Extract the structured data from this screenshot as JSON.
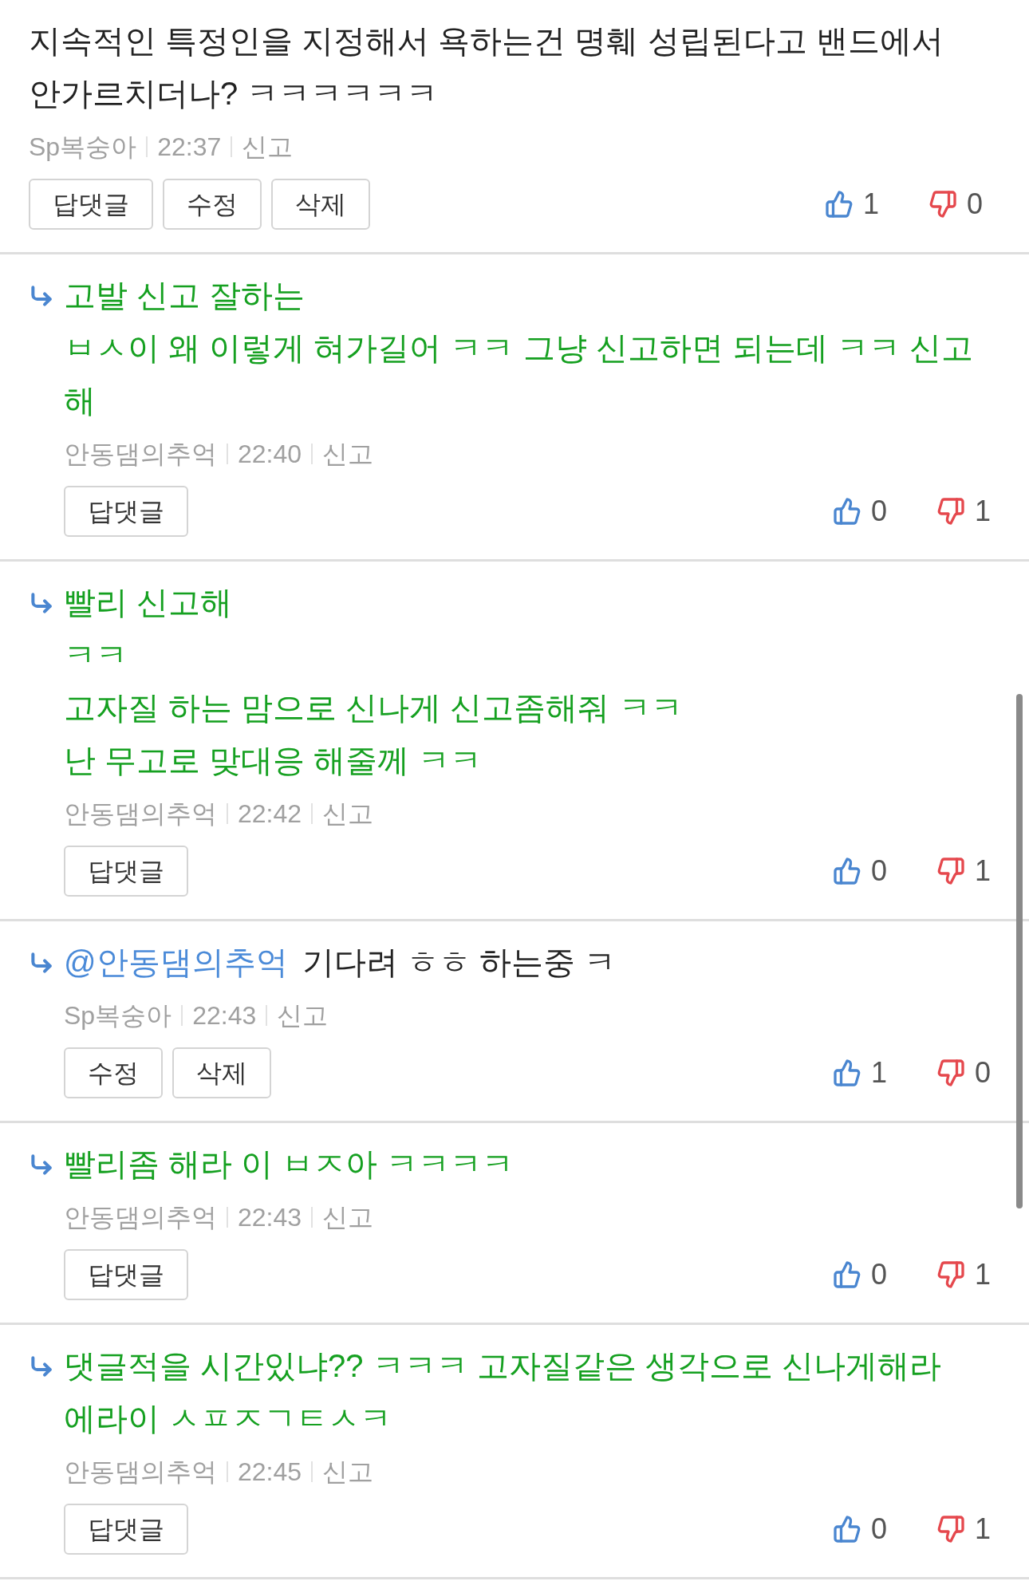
{
  "comments": [
    {
      "reply": false,
      "color": "#222222",
      "lines": [
        "지속적인 특정인을 지정해서 욕하는건 명훼 성립된다고 밴드에서 안가르치더나? ㅋㅋㅋㅋㅋㅋ"
      ],
      "author": "Sp복숭아",
      "time": "22:37",
      "report": "신고",
      "buttons": [
        "답댓글",
        "수정",
        "삭제"
      ],
      "likes": "1",
      "dislikes": "0"
    },
    {
      "reply": true,
      "color": "#15a020",
      "lines": [
        "고발 신고 잘하는",
        "ㅂㅅ이 왜 이렇게 혀가길어 ㅋㅋ 그냥 신고하면 되는데 ㅋㅋ 신고해"
      ],
      "author": "안동댐의추억",
      "time": "22:40",
      "report": "신고",
      "buttons": [
        "답댓글"
      ],
      "likes": "0",
      "dislikes": "1"
    },
    {
      "reply": true,
      "color": "#15a020",
      "lines": [
        "빨리 신고해",
        "ㅋㅋ",
        "고자질 하는 맘으로 신나게 신고좀해줘 ㅋㅋ",
        "난 무고로 맞대응 해줄께 ㅋㅋ"
      ],
      "author": "안동댐의추억",
      "time": "22:42",
      "report": "신고",
      "buttons": [
        "답댓글"
      ],
      "likes": "0",
      "dislikes": "1"
    },
    {
      "reply": true,
      "color": "#222222",
      "mention": "@안동댐의추억",
      "lines": [
        "기다려 ㅎㅎ 하는중 ㅋ"
      ],
      "author": "Sp복숭아",
      "time": "22:43",
      "report": "신고",
      "buttons": [
        "수정",
        "삭제"
      ],
      "likes": "1",
      "dislikes": "0"
    },
    {
      "reply": true,
      "color": "#15a020",
      "lines": [
        "빨리좀 해라 이 ㅂㅈ아 ㅋㅋㅋㅋ"
      ],
      "author": "안동댐의추억",
      "time": "22:43",
      "report": "신고",
      "buttons": [
        "답댓글"
      ],
      "likes": "0",
      "dislikes": "1"
    },
    {
      "reply": true,
      "color": "#15a020",
      "lines": [
        "댓글적을 시간있냐?? ㅋㅋㅋ 고자질같은 생각으로 신나게해라 에라이 ㅅㅍㅈㄱㅌㅅㅋ"
      ],
      "author": "안동댐의추억",
      "time": "22:45",
      "report": "신고",
      "buttons": [
        "답댓글"
      ],
      "likes": "0",
      "dislikes": "1"
    }
  ]
}
